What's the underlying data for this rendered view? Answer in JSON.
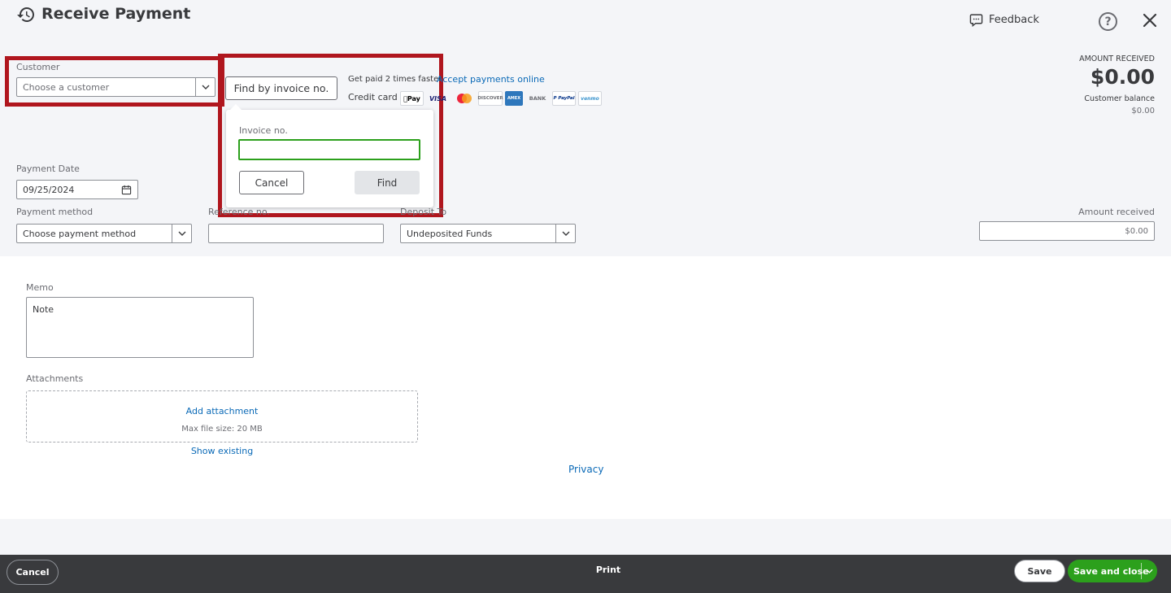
{
  "header": {
    "title": "Receive Payment",
    "feedback_label": "Feedback",
    "help_symbol": "?"
  },
  "customer": {
    "label": "Customer",
    "placeholder": "Choose a customer"
  },
  "find_invoice": {
    "button_label": "Find by invoice no.",
    "popover": {
      "field_label": "Invoice no.",
      "value": "",
      "cancel_label": "Cancel",
      "find_label": "Find"
    }
  },
  "promo": {
    "text": "Get paid 2 times faster",
    "link": "Accept payments online",
    "credit_card_label": "Credit card",
    "logos": [
      "apple-pay",
      "visa",
      "mastercard",
      "discover",
      "amex",
      "bank",
      "paypal",
      "venmo"
    ],
    "logo_texts": {
      "apple_pay": "Pay",
      "visa": "VISA",
      "discover": "DISCOVER",
      "amex": "AMEX",
      "bank": "BANK",
      "paypal": "P PayPal",
      "venmo": "venmo"
    }
  },
  "amount_received_block": {
    "label": "AMOUNT RECEIVED",
    "value": "$0.00",
    "balance_label": "Customer balance",
    "balance_value": "$0.00"
  },
  "payment_date": {
    "label": "Payment Date",
    "value": "09/25/2024"
  },
  "payment_method": {
    "label": "Payment method",
    "placeholder": "Choose payment method"
  },
  "reference": {
    "label": "Reference no.",
    "value": ""
  },
  "deposit_to": {
    "label": "Deposit To",
    "value": "Undeposited Funds"
  },
  "amount_field": {
    "label": "Amount received",
    "value": "$0.00"
  },
  "memo": {
    "label": "Memo",
    "placeholder": "Note"
  },
  "attachments": {
    "label": "Attachments",
    "add_label": "Add attachment",
    "max_size": "Max file size: 20 MB",
    "show_existing": "Show existing"
  },
  "privacy_label": "Privacy",
  "footer": {
    "cancel_label": "Cancel",
    "print_label": "Print",
    "save_label": "Save",
    "save_close_label": "Save and close"
  },
  "colors": {
    "highlight_red": "#b0161e",
    "brand_green": "#2ca01c",
    "link_blue": "#0b6ab7",
    "footer_bg": "#393a3d"
  }
}
